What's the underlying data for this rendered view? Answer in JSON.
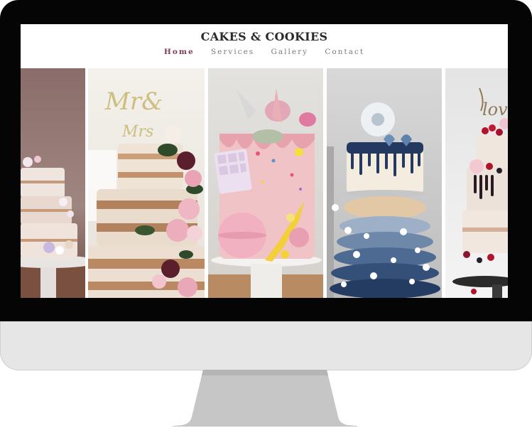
{
  "site": {
    "brand": "CAKES & COOKIES",
    "nav": [
      {
        "label": "Home",
        "active": true
      },
      {
        "label": "Services",
        "active": false
      },
      {
        "label": "Gallery",
        "active": false
      },
      {
        "label": "Contact",
        "active": false
      }
    ]
  },
  "gallery": {
    "images": [
      {
        "subject": "naked cake with flowers (partial)"
      },
      {
        "subject": "naked cake with Mr & Mrs topper and roses"
      },
      {
        "subject": "pink drip cake with macarons and chocolate"
      },
      {
        "subject": "blue drip cake on macaron tower"
      },
      {
        "subject": "semi-naked cake with berries and love topper (partial)"
      }
    ],
    "topper_left": "Mr&",
    "topper_left_2": "Mrs",
    "topper_right": "love"
  },
  "colors": {
    "accent": "#7b3b55",
    "nav_text": "#7a7a7a",
    "brand_text": "#2a2a2a",
    "bezel": "#050505",
    "chin": "#e6e6e6"
  }
}
